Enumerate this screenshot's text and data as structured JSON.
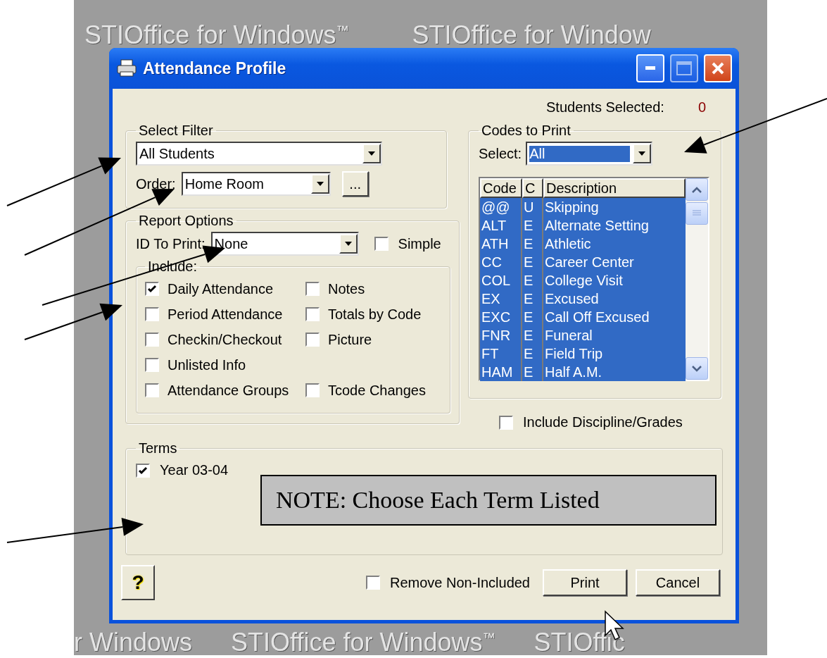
{
  "backdrop": {
    "top_row": [
      "STIOffice for Windows$^{™}$",
      "STIOffice for Window"
    ],
    "bottom_row": [
      "r Windows",
      "STIOffice for Windows$^{™}$",
      "STIOffic"
    ]
  },
  "window": {
    "title": "Attendance Profile"
  },
  "students_selected": {
    "label": "Students Selected:",
    "value": "0"
  },
  "select_filter": {
    "title": "Select Filter",
    "filter": "All Students",
    "order_label": "Order:",
    "order": "Home Room",
    "more_button": "..."
  },
  "report_options": {
    "title": "Report Options",
    "id_label": "ID To Print:",
    "id_value": "None",
    "simple": {
      "label": "Simple",
      "checked": false
    },
    "include": {
      "title": "Include:",
      "rows": [
        [
          {
            "label": "Daily Attendance",
            "checked": true
          },
          {
            "label": "Notes",
            "checked": false
          }
        ],
        [
          {
            "label": "Period Attendance",
            "checked": false
          },
          {
            "label": "Totals by Code",
            "checked": false
          }
        ],
        [
          {
            "label": "Checkin/Checkout",
            "checked": false
          },
          {
            "label": "Picture",
            "checked": false
          }
        ],
        [
          {
            "label": "Unlisted Info",
            "checked": false
          }
        ],
        [
          {
            "label": "Attendance Groups",
            "checked": false
          },
          {
            "label": "Tcode Changes",
            "checked": false
          }
        ]
      ]
    }
  },
  "codes_to_print": {
    "title": "Codes to Print",
    "select_label": "Select:",
    "select_value": "All",
    "columns": [
      "Code",
      "C",
      "Description"
    ],
    "rows": [
      {
        "code": "@@",
        "c": "U",
        "description": "Skipping",
        "selected": true
      },
      {
        "code": "ALT",
        "c": "E",
        "description": "Alternate Setting",
        "selected": true
      },
      {
        "code": "ATH",
        "c": "E",
        "description": "Athletic",
        "selected": true
      },
      {
        "code": "CC",
        "c": "E",
        "description": "Career Center",
        "selected": true
      },
      {
        "code": "COL",
        "c": "E",
        "description": "College Visit",
        "selected": true
      },
      {
        "code": "EX",
        "c": "E",
        "description": "Excused",
        "selected": true
      },
      {
        "code": "EXC",
        "c": "E",
        "description": "Call Off Excused",
        "selected": true
      },
      {
        "code": "FNR",
        "c": "E",
        "description": "Funeral",
        "selected": true
      },
      {
        "code": "FT",
        "c": "E",
        "description": "Field Trip",
        "selected": true
      },
      {
        "code": "HAM",
        "c": "E",
        "description": "Half A.M.",
        "selected": true
      }
    ]
  },
  "include_discipline": {
    "label": "Include Discipline/Grades",
    "checked": false
  },
  "terms": {
    "title": "Terms",
    "items": [
      {
        "label": "Year 03-04",
        "checked": true
      }
    ]
  },
  "note": {
    "text": "NOTE: Choose Each Term Listed"
  },
  "footer": {
    "help": "?",
    "remove": {
      "label": "Remove Non-Included",
      "checked": false
    },
    "buttons": [
      "Print",
      "Cancel"
    ]
  }
}
